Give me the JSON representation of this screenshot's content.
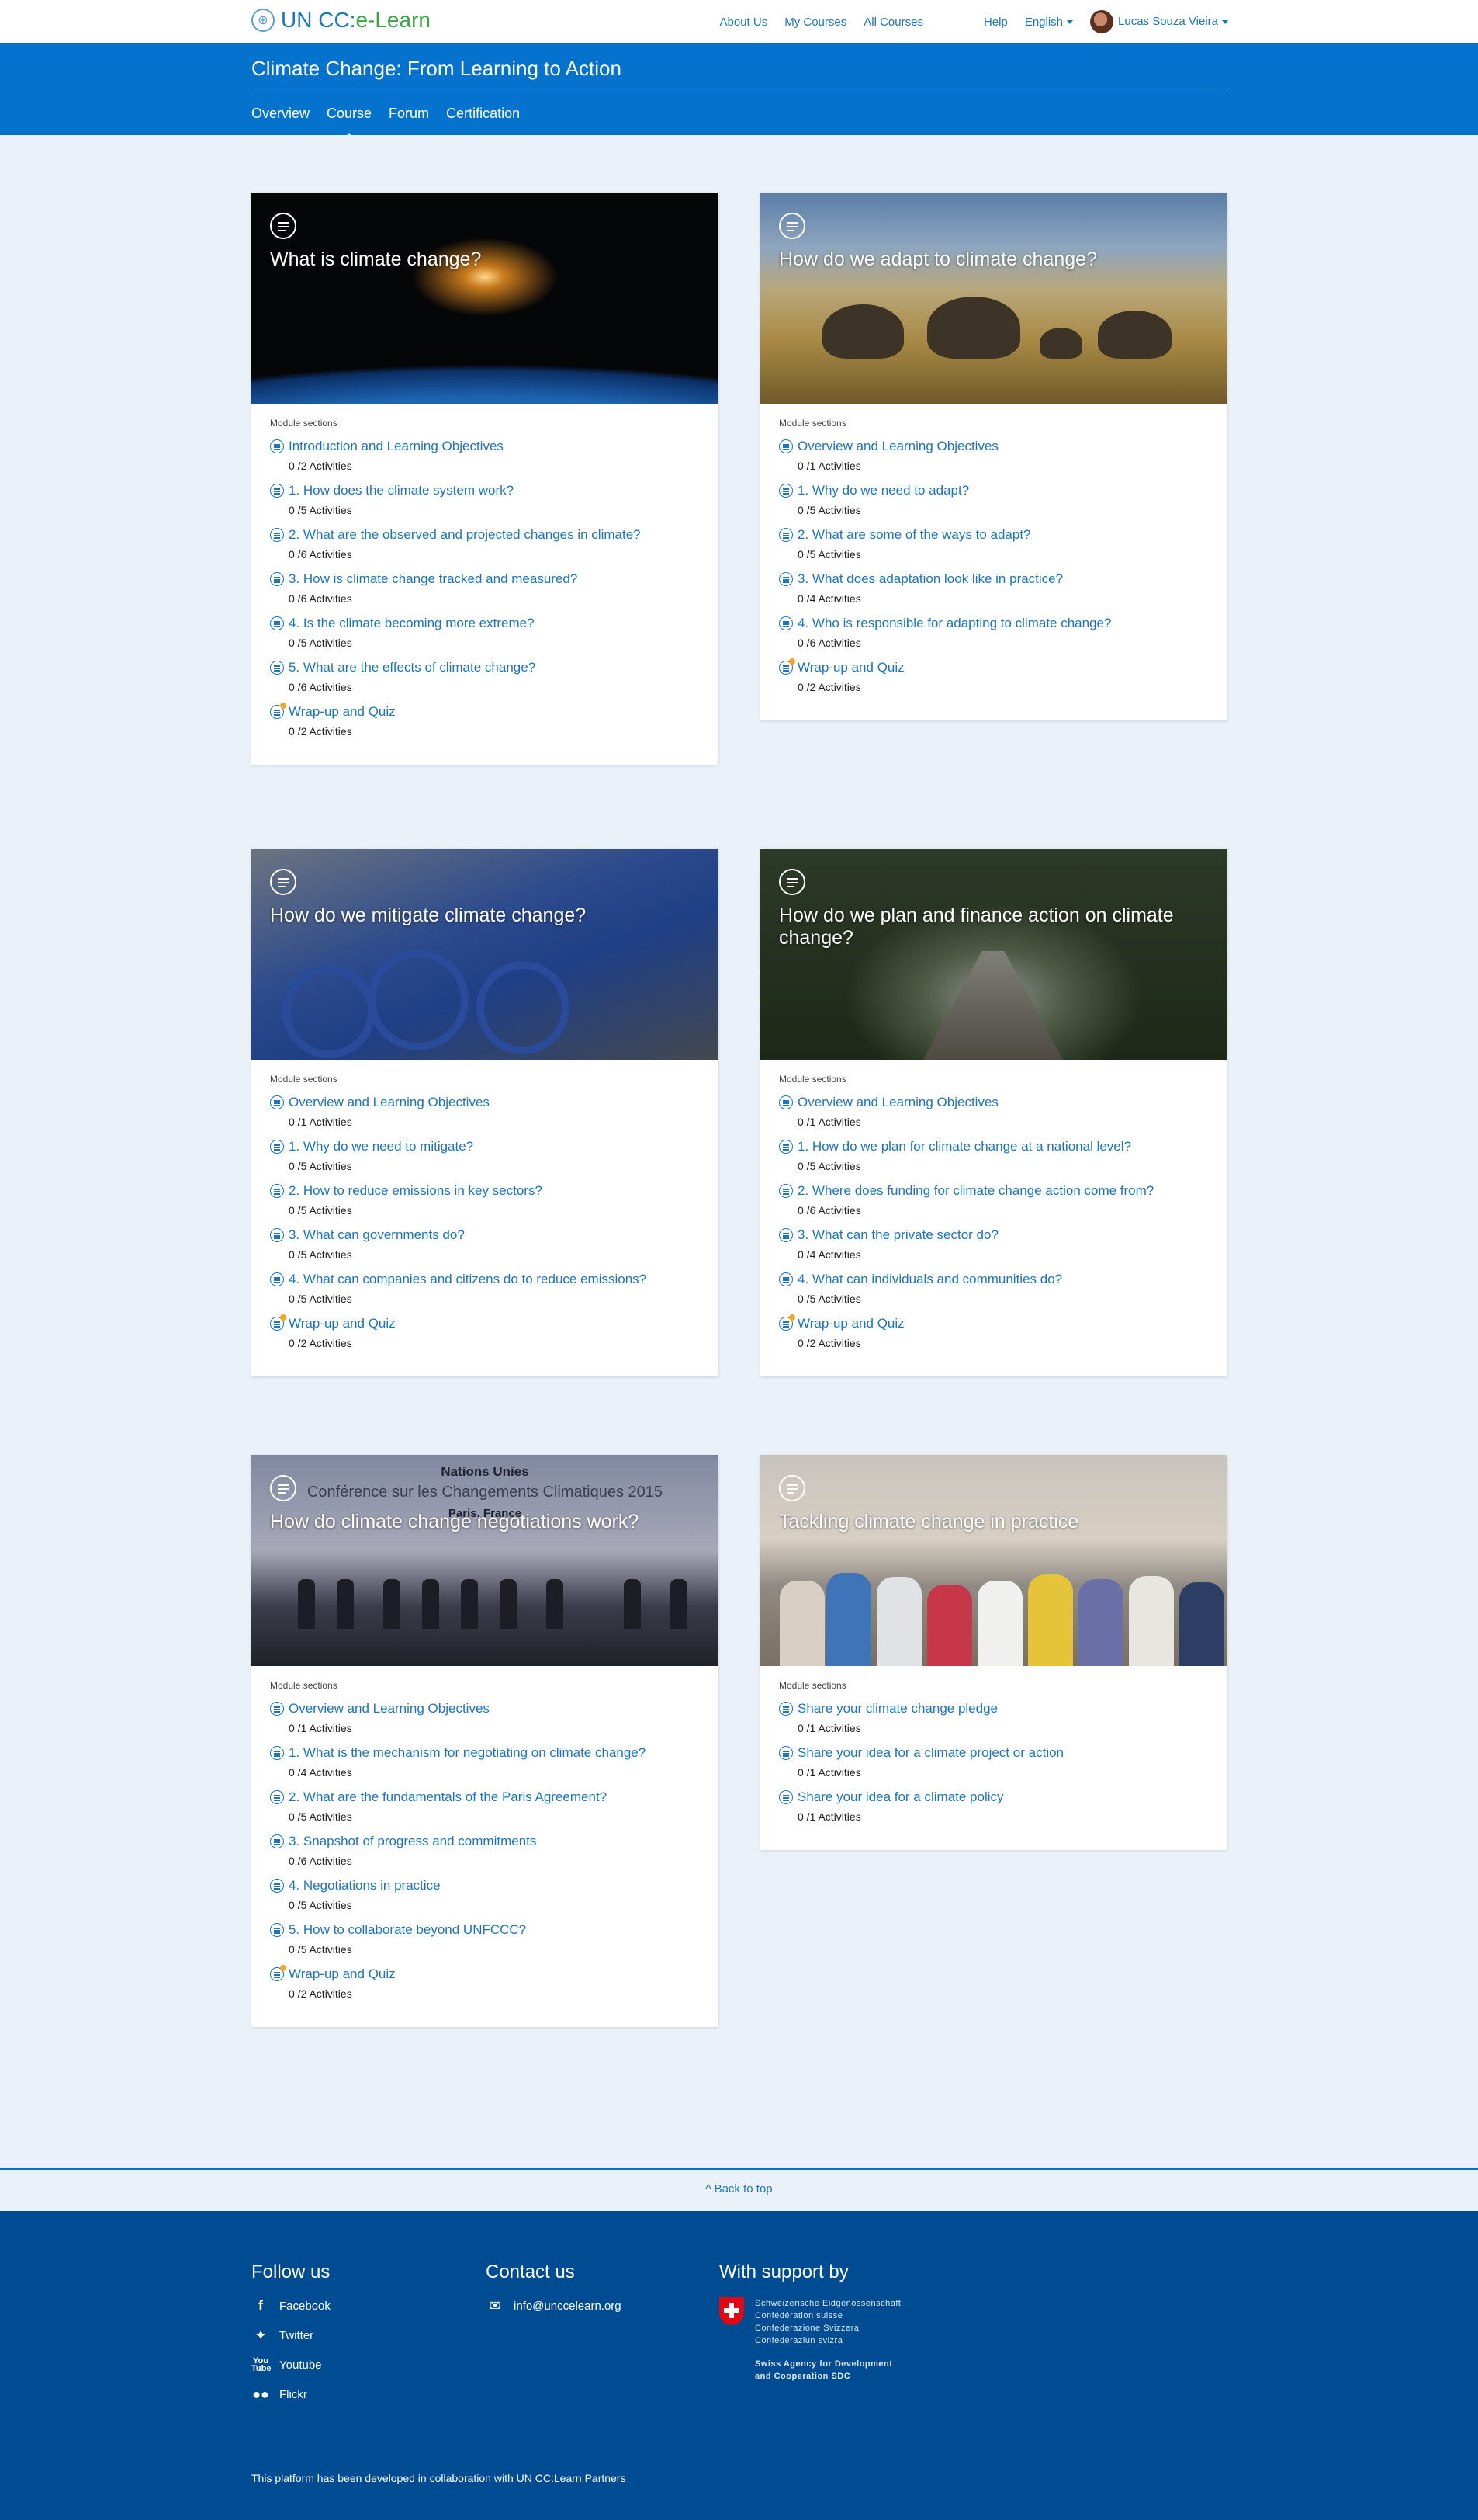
{
  "brand": {
    "name_main": "UN CC:",
    "name_accent": "e-Learn"
  },
  "topnav": {
    "about": "About Us",
    "my_courses": "My Courses",
    "all_courses": "All Courses",
    "help": "Help",
    "language": "English",
    "user": "Lucas Souza Vieira"
  },
  "course": {
    "title": "Climate Change: From Learning to Action",
    "tabs": [
      "Overview",
      "Course",
      "Forum",
      "Certification"
    ],
    "active_tab": "Course"
  },
  "modules": [
    {
      "title": "What is climate change?",
      "label": "Module sections",
      "sections": [
        {
          "name": "Introduction and Learning Objectives",
          "acts": "0 /2 Activities"
        },
        {
          "name": "1. How does the climate system work?",
          "acts": "0 /5 Activities"
        },
        {
          "name": "2. What are the observed and projected changes in climate?",
          "acts": "0 /6 Activities"
        },
        {
          "name": "3. How is climate change tracked and measured?",
          "acts": "0 /6 Activities"
        },
        {
          "name": "4. Is the climate becoming more extreme?",
          "acts": "0 /5 Activities"
        },
        {
          "name": "5. What are the effects of climate change?",
          "acts": "0 /6 Activities"
        },
        {
          "name": "Wrap-up and Quiz",
          "acts": "0 /2 Activities"
        }
      ]
    },
    {
      "title": "How do we adapt to climate change?",
      "label": "Module sections",
      "sections": [
        {
          "name": "Overview and Learning Objectives",
          "acts": "0 /1 Activities"
        },
        {
          "name": "1. Why do we need to adapt?",
          "acts": "0 /5 Activities"
        },
        {
          "name": "2. What are some of the ways to adapt?",
          "acts": "0 /5 Activities"
        },
        {
          "name": "3. What does adaptation look like in practice?",
          "acts": "0 /4 Activities"
        },
        {
          "name": "4. Who is responsible for adapting to climate change?",
          "acts": "0 /6 Activities"
        },
        {
          "name": "Wrap-up and Quiz",
          "acts": "0 /2 Activities"
        }
      ]
    },
    {
      "title": "How do we mitigate climate change?",
      "label": "Module sections",
      "sections": [
        {
          "name": "Overview and Learning Objectives",
          "acts": "0 /1 Activities"
        },
        {
          "name": "1. Why do we need to mitigate?",
          "acts": "0 /5 Activities"
        },
        {
          "name": "2. How to reduce emissions in key sectors?",
          "acts": "0 /5 Activities"
        },
        {
          "name": "3. What can governments do?",
          "acts": "0 /5 Activities"
        },
        {
          "name": "4. What can companies and citizens do to reduce emissions?",
          "acts": "0 /5 Activities"
        },
        {
          "name": "Wrap-up and Quiz",
          "acts": "0 /2 Activities"
        }
      ]
    },
    {
      "title": "How do we plan and finance action on climate change?",
      "label": "Module sections",
      "sections": [
        {
          "name": "Overview and Learning Objectives",
          "acts": "0 /1 Activities"
        },
        {
          "name": "1. How do we plan for climate change at a national level?",
          "acts": "0 /5 Activities"
        },
        {
          "name": "2. Where does funding for climate change action come from?",
          "acts": "0 /6 Activities"
        },
        {
          "name": "3. What can the private sector do?",
          "acts": "0 /4 Activities"
        },
        {
          "name": "4. What can individuals and communities do?",
          "acts": "0 /5 Activities"
        },
        {
          "name": "Wrap-up and Quiz",
          "acts": "0 /2 Activities"
        }
      ]
    },
    {
      "title": "How do climate change negotiations work?",
      "label": "Module sections",
      "sections": [
        {
          "name": "Overview and Learning Objectives",
          "acts": "0 /1 Activities"
        },
        {
          "name": "1. What is the mechanism for negotiating on climate change?",
          "acts": "0 /4 Activities"
        },
        {
          "name": "2. What are the fundamentals of the Paris Agreement?",
          "acts": "0 /5 Activities"
        },
        {
          "name": "3. Snapshot of progress and commitments",
          "acts": "0 /6 Activities"
        },
        {
          "name": "4. Negotiations in practice",
          "acts": "0 /5 Activities"
        },
        {
          "name": "5. How to collaborate beyond UNFCCC?",
          "acts": "0 /5 Activities"
        },
        {
          "name": "Wrap-up and Quiz",
          "acts": "0 /2 Activities"
        }
      ],
      "photo_text": [
        "Nations Unies",
        "Conférence sur les Changements Climatiques 2015",
        "Paris, France"
      ]
    },
    {
      "title": "Tackling climate change in practice",
      "label": "Module sections",
      "sections": [
        {
          "name": "Share your climate change pledge",
          "acts": "0 /1 Activities"
        },
        {
          "name": "Share your idea for a climate project or action",
          "acts": "0 /1 Activities"
        },
        {
          "name": "Share your idea for a climate policy",
          "acts": "0 /1 Activities"
        }
      ]
    }
  ],
  "back_to_top": "Back to top",
  "footer": {
    "follow_title": "Follow us",
    "follow_links": [
      {
        "icon": "facebook-icon",
        "label": "Facebook"
      },
      {
        "icon": "twitter-icon",
        "label": "Twitter"
      },
      {
        "icon": "youtube-icon",
        "label": "Youtube"
      },
      {
        "icon": "flickr-icon",
        "label": "Flickr"
      }
    ],
    "contact_title": "Contact us",
    "email": "info@unccelearn.org",
    "support_title": "With support by",
    "swiss_lines": [
      "Schweizerische Eidgenossenschaft",
      "Confédération suisse",
      "Confederazione Svizzera",
      "Confederaziun svizra"
    ],
    "sdc_lines": [
      "Swiss Agency for Development",
      "and Cooperation SDC"
    ],
    "note": "This platform has been developed in collaboration with UN CC:Learn Partners"
  },
  "colors": {
    "primary_blue": "#0572ce",
    "link_blue": "#1b75bc",
    "footer_blue": "#004c93",
    "page_bg": "#eaf1f9",
    "quiz_badge": "#f5a623"
  }
}
